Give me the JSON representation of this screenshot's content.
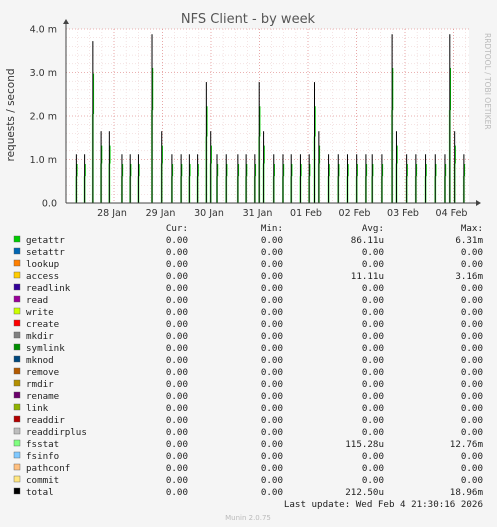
{
  "title": "NFS Client - by week",
  "ylabel": "requests / second",
  "side_label": "RRDTOOL / TOBI OETIKER",
  "footer": {
    "last_update": "Last update: Wed Feb  4 21:30:16 2026",
    "munin_version": "Munin 2.0.75"
  },
  "legend_headers": {
    "cur": "Cur:",
    "min": "Min:",
    "avg": "Avg:",
    "max": "Max:"
  },
  "legend": [
    {
      "name": "getattr",
      "color": "#00cc00",
      "cur": "0.00",
      "min": "0.00",
      "avg": "86.11u",
      "max": "6.31m"
    },
    {
      "name": "setattr",
      "color": "#0066b3",
      "cur": "0.00",
      "min": "0.00",
      "avg": "0.00",
      "max": "0.00"
    },
    {
      "name": "lookup",
      "color": "#ff8000",
      "cur": "0.00",
      "min": "0.00",
      "avg": "0.00",
      "max": "0.00"
    },
    {
      "name": "access",
      "color": "#ffcc00",
      "cur": "0.00",
      "min": "0.00",
      "avg": "11.11u",
      "max": "3.16m"
    },
    {
      "name": "readlink",
      "color": "#330099",
      "cur": "0.00",
      "min": "0.00",
      "avg": "0.00",
      "max": "0.00"
    },
    {
      "name": "read",
      "color": "#990099",
      "cur": "0.00",
      "min": "0.00",
      "avg": "0.00",
      "max": "0.00"
    },
    {
      "name": "write",
      "color": "#ccff00",
      "cur": "0.00",
      "min": "0.00",
      "avg": "0.00",
      "max": "0.00"
    },
    {
      "name": "create",
      "color": "#ff0000",
      "cur": "0.00",
      "min": "0.00",
      "avg": "0.00",
      "max": "0.00"
    },
    {
      "name": "mkdir",
      "color": "#808080",
      "cur": "0.00",
      "min": "0.00",
      "avg": "0.00",
      "max": "0.00"
    },
    {
      "name": "symlink",
      "color": "#008f00",
      "cur": "0.00",
      "min": "0.00",
      "avg": "0.00",
      "max": "0.00"
    },
    {
      "name": "mknod",
      "color": "#00487d",
      "cur": "0.00",
      "min": "0.00",
      "avg": "0.00",
      "max": "0.00"
    },
    {
      "name": "remove",
      "color": "#b35a00",
      "cur": "0.00",
      "min": "0.00",
      "avg": "0.00",
      "max": "0.00"
    },
    {
      "name": "rmdir",
      "color": "#b38f00",
      "cur": "0.00",
      "min": "0.00",
      "avg": "0.00",
      "max": "0.00"
    },
    {
      "name": "rename",
      "color": "#6b006b",
      "cur": "0.00",
      "min": "0.00",
      "avg": "0.00",
      "max": "0.00"
    },
    {
      "name": "link",
      "color": "#8fb300",
      "cur": "0.00",
      "min": "0.00",
      "avg": "0.00",
      "max": "0.00"
    },
    {
      "name": "readdir",
      "color": "#b30000",
      "cur": "0.00",
      "min": "0.00",
      "avg": "0.00",
      "max": "0.00"
    },
    {
      "name": "readdirplus",
      "color": "#bebebe",
      "cur": "0.00",
      "min": "0.00",
      "avg": "0.00",
      "max": "0.00"
    },
    {
      "name": "fsstat",
      "color": "#80ff80",
      "cur": "0.00",
      "min": "0.00",
      "avg": "115.28u",
      "max": "12.76m"
    },
    {
      "name": "fsinfo",
      "color": "#80c9ff",
      "cur": "0.00",
      "min": "0.00",
      "avg": "0.00",
      "max": "0.00"
    },
    {
      "name": "pathconf",
      "color": "#ffc080",
      "cur": "0.00",
      "min": "0.00",
      "avg": "0.00",
      "max": "0.00"
    },
    {
      "name": "commit",
      "color": "#ffe680",
      "cur": "0.00",
      "min": "0.00",
      "avg": "0.00",
      "max": "0.00"
    },
    {
      "name": "total",
      "color": "#000000",
      "cur": "0.00",
      "min": "0.00",
      "avg": "212.50u",
      "max": "18.96m"
    }
  ],
  "chart_data": {
    "type": "line",
    "title": "NFS Client - by week",
    "ylabel": "requests / second",
    "xlabel": "",
    "ylim": [
      0,
      0.004
    ],
    "yticks": [
      {
        "value": 0.0,
        "label": "0.0"
      },
      {
        "value": 0.001,
        "label": "1.0 m"
      },
      {
        "value": 0.002,
        "label": "2.0 m"
      },
      {
        "value": 0.003,
        "label": "3.0 m"
      },
      {
        "value": 0.004,
        "label": "4.0 m"
      }
    ],
    "xlim": [
      0,
      8
    ],
    "xticks": [
      {
        "value": 1,
        "label": "28 Jan"
      },
      {
        "value": 2,
        "label": "29 Jan"
      },
      {
        "value": 3,
        "label": "30 Jan"
      },
      {
        "value": 4,
        "label": "31 Jan"
      },
      {
        "value": 5,
        "label": "01 Feb"
      },
      {
        "value": 6,
        "label": "02 Feb"
      },
      {
        "value": 7,
        "label": "03 Feb"
      },
      {
        "value": 8,
        "label": "04 Feb"
      }
    ],
    "grid": true,
    "spikes": [
      [
        0.09,
        0.00112
      ],
      [
        0.26,
        0.00112
      ],
      [
        0.43,
        0.00372
      ],
      [
        0.6,
        0.00165
      ],
      [
        0.77,
        0.00165
      ],
      [
        1.03,
        0.00112
      ],
      [
        1.2,
        0.00112
      ],
      [
        1.37,
        0.00112
      ],
      [
        1.65,
        0.00388
      ],
      [
        1.85,
        0.00165
      ],
      [
        2.06,
        0.00112
      ],
      [
        2.25,
        0.00112
      ],
      [
        2.42,
        0.00112
      ],
      [
        2.59,
        0.00112
      ],
      [
        2.77,
        0.00278
      ],
      [
        2.86,
        0.00165
      ],
      [
        2.99,
        0.00112
      ],
      [
        3.18,
        0.00112
      ],
      [
        3.42,
        0.00112
      ],
      [
        3.59,
        0.00112
      ],
      [
        3.77,
        0.00112
      ],
      [
        3.86,
        0.00278
      ],
      [
        3.95,
        0.00165
      ],
      [
        4.16,
        0.00112
      ],
      [
        4.35,
        0.00112
      ],
      [
        4.52,
        0.00112
      ],
      [
        4.71,
        0.00112
      ],
      [
        4.89,
        0.00112
      ],
      [
        5.0,
        0.00278
      ],
      [
        5.09,
        0.00165
      ],
      [
        5.29,
        0.00112
      ],
      [
        5.49,
        0.00112
      ],
      [
        5.68,
        0.00112
      ],
      [
        5.87,
        0.00112
      ],
      [
        6.06,
        0.00112
      ],
      [
        6.19,
        0.00112
      ],
      [
        6.39,
        0.00112
      ],
      [
        6.6,
        0.00388
      ],
      [
        6.69,
        0.00165
      ],
      [
        6.9,
        0.00112
      ],
      [
        7.09,
        0.00112
      ],
      [
        7.29,
        0.00112
      ],
      [
        7.49,
        0.00112
      ],
      [
        7.69,
        0.00112
      ],
      [
        7.79,
        0.00388
      ],
      [
        7.89,
        0.00165
      ],
      [
        8.08,
        0.00112
      ],
      [
        8.28,
        0.00112
      ],
      [
        8.47,
        0.00112
      ],
      [
        8.67,
        0.00112
      ]
    ],
    "series": [
      {
        "name": "total",
        "color": "#000000"
      },
      {
        "name": "fsstat",
        "color": "#80ff80"
      },
      {
        "name": "getattr",
        "color": "#00cc00"
      }
    ]
  }
}
